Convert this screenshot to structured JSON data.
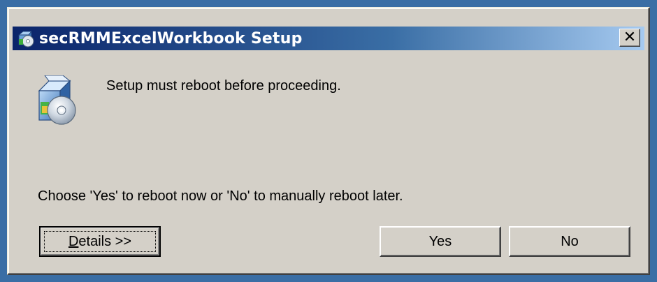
{
  "window": {
    "title": "secRMMExcelWorkbook Setup",
    "close_glyph": "✕"
  },
  "content": {
    "message": "Setup must reboot before proceeding.",
    "instruction": "Choose 'Yes' to reboot now or 'No' to manually reboot later."
  },
  "buttons": {
    "details_mnemonic": "D",
    "details_rest": "etails >>",
    "yes_label": "Yes",
    "no_label": "No"
  },
  "icons": {
    "title": "setup-installer-icon",
    "main": "setup-installer-icon"
  },
  "colors": {
    "desktop": "#3a6ea5",
    "titlebar_start": "#0a246a",
    "titlebar_end": "#a6caf0",
    "dialog_face": "#d4d0c8"
  }
}
